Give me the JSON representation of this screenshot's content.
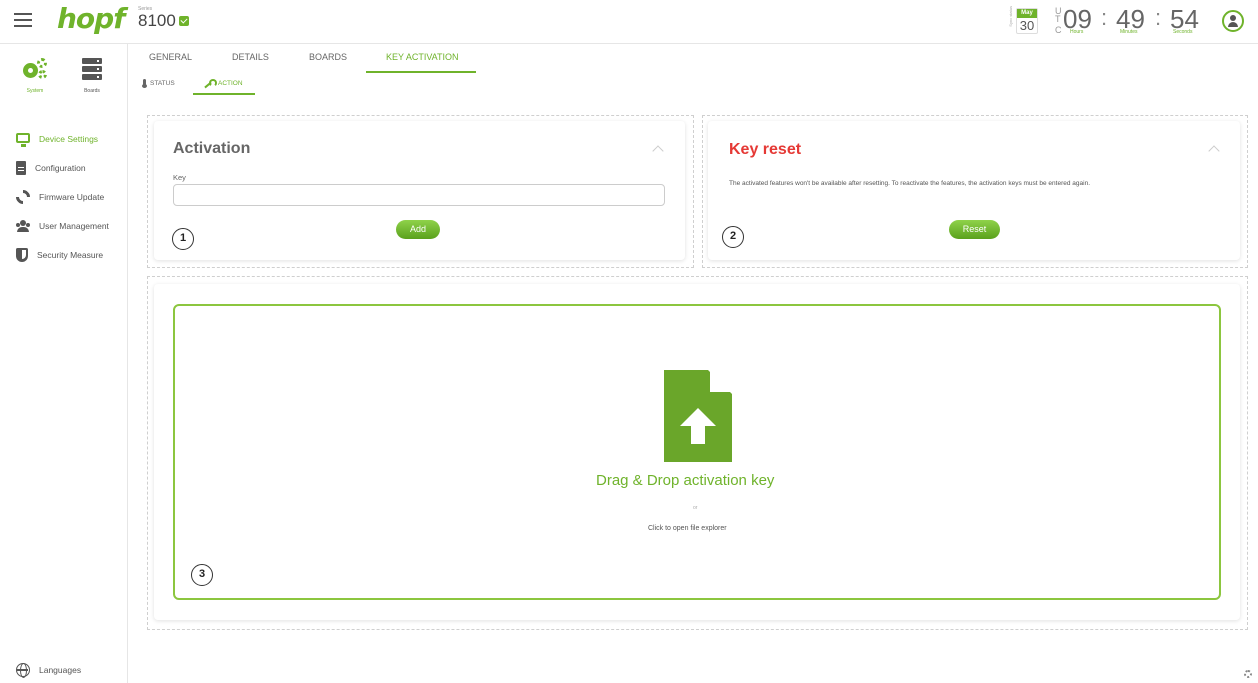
{
  "app": {
    "logo": "hopf",
    "series_label": "Series",
    "series_value": "8100"
  },
  "clock": {
    "status_label": "Sync status",
    "month": "May",
    "day": "30",
    "tz_letters": [
      "U",
      "T",
      "C"
    ],
    "hours": "09",
    "minutes": "49",
    "seconds": "54",
    "hours_label": "Hours",
    "minutes_label": "Minutes",
    "seconds_label": "Seconds",
    "colon": ":"
  },
  "sidebar": {
    "top": [
      {
        "label": "System",
        "icon": "gears-icon"
      },
      {
        "label": "Boards",
        "icon": "server-icon"
      }
    ],
    "items": [
      {
        "label": "Device Settings",
        "icon": "monitor-icon",
        "active": true
      },
      {
        "label": "Configuration",
        "icon": "document-icon"
      },
      {
        "label": "Firmware Update",
        "icon": "refresh-icon"
      },
      {
        "label": "User Management",
        "icon": "users-icon"
      },
      {
        "label": "Security Measure",
        "icon": "shield-icon"
      }
    ],
    "languages": "Languages"
  },
  "tabs": [
    {
      "label": "GENERAL"
    },
    {
      "label": "DETAILS"
    },
    {
      "label": "BOARDS"
    },
    {
      "label": "KEY ACTIVATION",
      "active": true
    }
  ],
  "subtabs": [
    {
      "label": "STATUS",
      "icon": "thermometer-icon"
    },
    {
      "label": "ACTION",
      "icon": "wrench-icon",
      "active": true
    }
  ],
  "activation": {
    "title": "Activation",
    "key_label": "Key",
    "key_value": "",
    "add_button": "Add",
    "badge": "1"
  },
  "key_reset": {
    "title": "Key reset",
    "description": "The activated features won't be available after resetting. To reactivate the features, the activation keys must be entered again.",
    "reset_button": "Reset",
    "badge": "2"
  },
  "upload": {
    "title": "Drag & Drop activation key",
    "or": "or",
    "click_text": "Click to open file explorer",
    "badge": "3"
  },
  "colors": {
    "accent": "#6fb32b",
    "danger": "#e53935"
  }
}
